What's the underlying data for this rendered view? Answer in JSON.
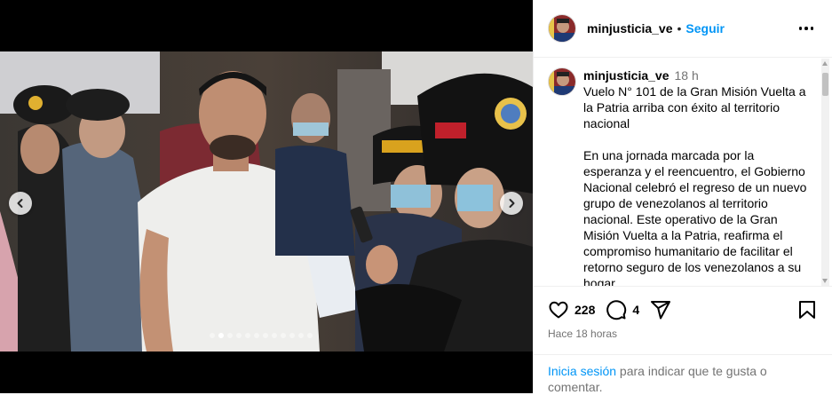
{
  "post": {
    "username": "minjusticia_ve",
    "separator": "•",
    "follow_label": "Seguir",
    "time_ago_short": "18 h",
    "caption_lead": "Vuelo N° 101 de la Gran Misión Vuelta a la Patria arriba con éxito al territorio nacional",
    "caption_body": "En una jornada marcada por la esperanza y el reencuentro, el Gobierno Nacional celebró el regreso de un nuevo grupo de venezolanos al territorio nacional. Este operativo de la Gran Misión Vuelta a la Patria, reafirma el compromiso humanitario de facilitar el retorno seguro de los venezolanos a su hogar.",
    "likes": "228",
    "comments": "4",
    "posted_ago": "Hace 18 horas",
    "login_link": "Inicia sesión",
    "login_rest": " para indicar que te gusta o comentar."
  },
  "carousel": {
    "total_slides": 12,
    "active_index": 1
  },
  "icons": {
    "more": "more-options-icon",
    "like": "heart-icon",
    "comment": "comment-icon",
    "share": "share-icon",
    "save": "bookmark-icon",
    "prev": "chevron-left-icon",
    "next": "chevron-right-icon"
  },
  "colors": {
    "link": "#0095f6",
    "muted": "#737373"
  }
}
